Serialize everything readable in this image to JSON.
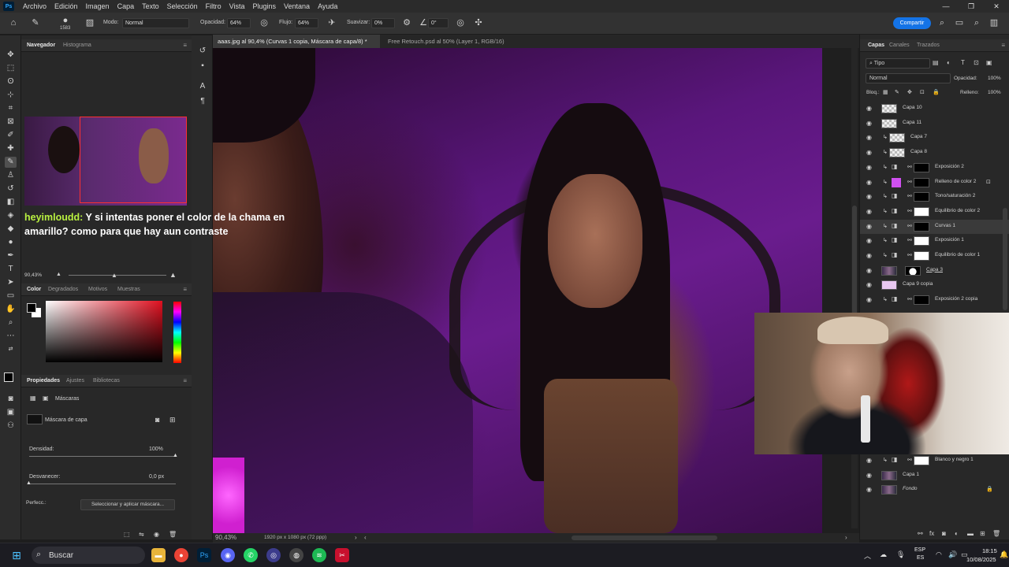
{
  "app": {
    "logo": "Ps",
    "menu": [
      "Archivo",
      "Edición",
      "Imagen",
      "Capa",
      "Texto",
      "Selección",
      "Filtro",
      "Vista",
      "Plugins",
      "Ventana",
      "Ayuda"
    ],
    "window_controls": [
      "—",
      "❐",
      "✕"
    ]
  },
  "options_bar": {
    "brush_size": "1583",
    "mode_label": "Modo:",
    "mode_value": "Normal",
    "opacity_label": "Opacidad:",
    "opacity_value": "64%",
    "flow_label": "Flujo:",
    "flow_value": "64%",
    "smoothing_label": "Suavizar:",
    "smoothing_value": "0%",
    "angle_value": "0°",
    "share_label": "Compartir"
  },
  "navigator": {
    "tabs": [
      "Navegador",
      "Histograma"
    ],
    "zoom": "90,43%"
  },
  "chat_overlay": {
    "user": "heyimloudd:",
    "message": " Y si intentas poner el color de la chama en amarillo? como para que hay aun contraste"
  },
  "color_panel": {
    "tabs": [
      "Color",
      "Degradados",
      "Motivos",
      "Muestras"
    ],
    "hue_color": "#e01020"
  },
  "properties": {
    "tabs": [
      "Propiedades",
      "Ajustes",
      "Bibliotecas"
    ],
    "section": "Máscaras",
    "mask_label": "Máscara de capa",
    "density_label": "Densidad:",
    "density_value": "100%",
    "density_level": 100,
    "feather_label": "Desvanecer:",
    "feather_value": "0,0 px",
    "feather_level": 0,
    "refine_label": "Perfecc.:",
    "refine_button": "Seleccionar y aplicar máscara..."
  },
  "document_tabs": [
    {
      "label": "aaas.jpg al 90,4% (Curvas 1 copia, Máscara de capa/8) *",
      "close": "×"
    },
    {
      "label": "Free Retouch.psd al 50% (Layer 1, RGB/16)",
      "close": "×"
    }
  ],
  "status": {
    "zoom": "90,43%",
    "doc_info": "1920 px x 1080 px (72 ppp)"
  },
  "layers_panel": {
    "tabs": [
      "Capas",
      "Canales",
      "Trazados"
    ],
    "filter_label": "Tipo",
    "blend_mode": "Normal",
    "opacity_label": "Opacidad:",
    "opacity_value": "100%",
    "lock_label": "Bloq.:",
    "fill_label": "Relleno:",
    "fill_value": "100%",
    "layers": [
      {
        "name": "Capa 10",
        "kind": "pixel"
      },
      {
        "name": "Capa 11",
        "kind": "pixel"
      },
      {
        "name": "Capa 7",
        "kind": "clipped"
      },
      {
        "name": "Capa 8",
        "kind": "clipped"
      },
      {
        "name": "Exposición 2",
        "kind": "adjust"
      },
      {
        "name": "Relleno de color 2",
        "kind": "fill"
      },
      {
        "name": "Tono/saturación 2",
        "kind": "adjust"
      },
      {
        "name": "Equilibrio de color 2",
        "kind": "adjust"
      },
      {
        "name": "Curvas 1",
        "kind": "adjust"
      },
      {
        "name": "Exposición 1",
        "kind": "adjust"
      },
      {
        "name": "Equilibrio de color 1",
        "kind": "adjust"
      },
      {
        "name": "Capa 3",
        "kind": "photo"
      },
      {
        "name": "Capa 9 copia",
        "kind": "pink"
      },
      {
        "name": "Exposición 2 copia",
        "kind": "adjust"
      }
    ],
    "bottom_layers": [
      {
        "name": "Blanco y negro 1",
        "kind": "adjust"
      },
      {
        "name": "Capa 1",
        "kind": "photo"
      },
      {
        "name": "Fondo",
        "kind": "photo"
      }
    ]
  },
  "taskbar": {
    "search_placeholder": "Buscar",
    "language": "ESP",
    "region": "ES",
    "time": "18:15",
    "date": "10/08/2025"
  }
}
